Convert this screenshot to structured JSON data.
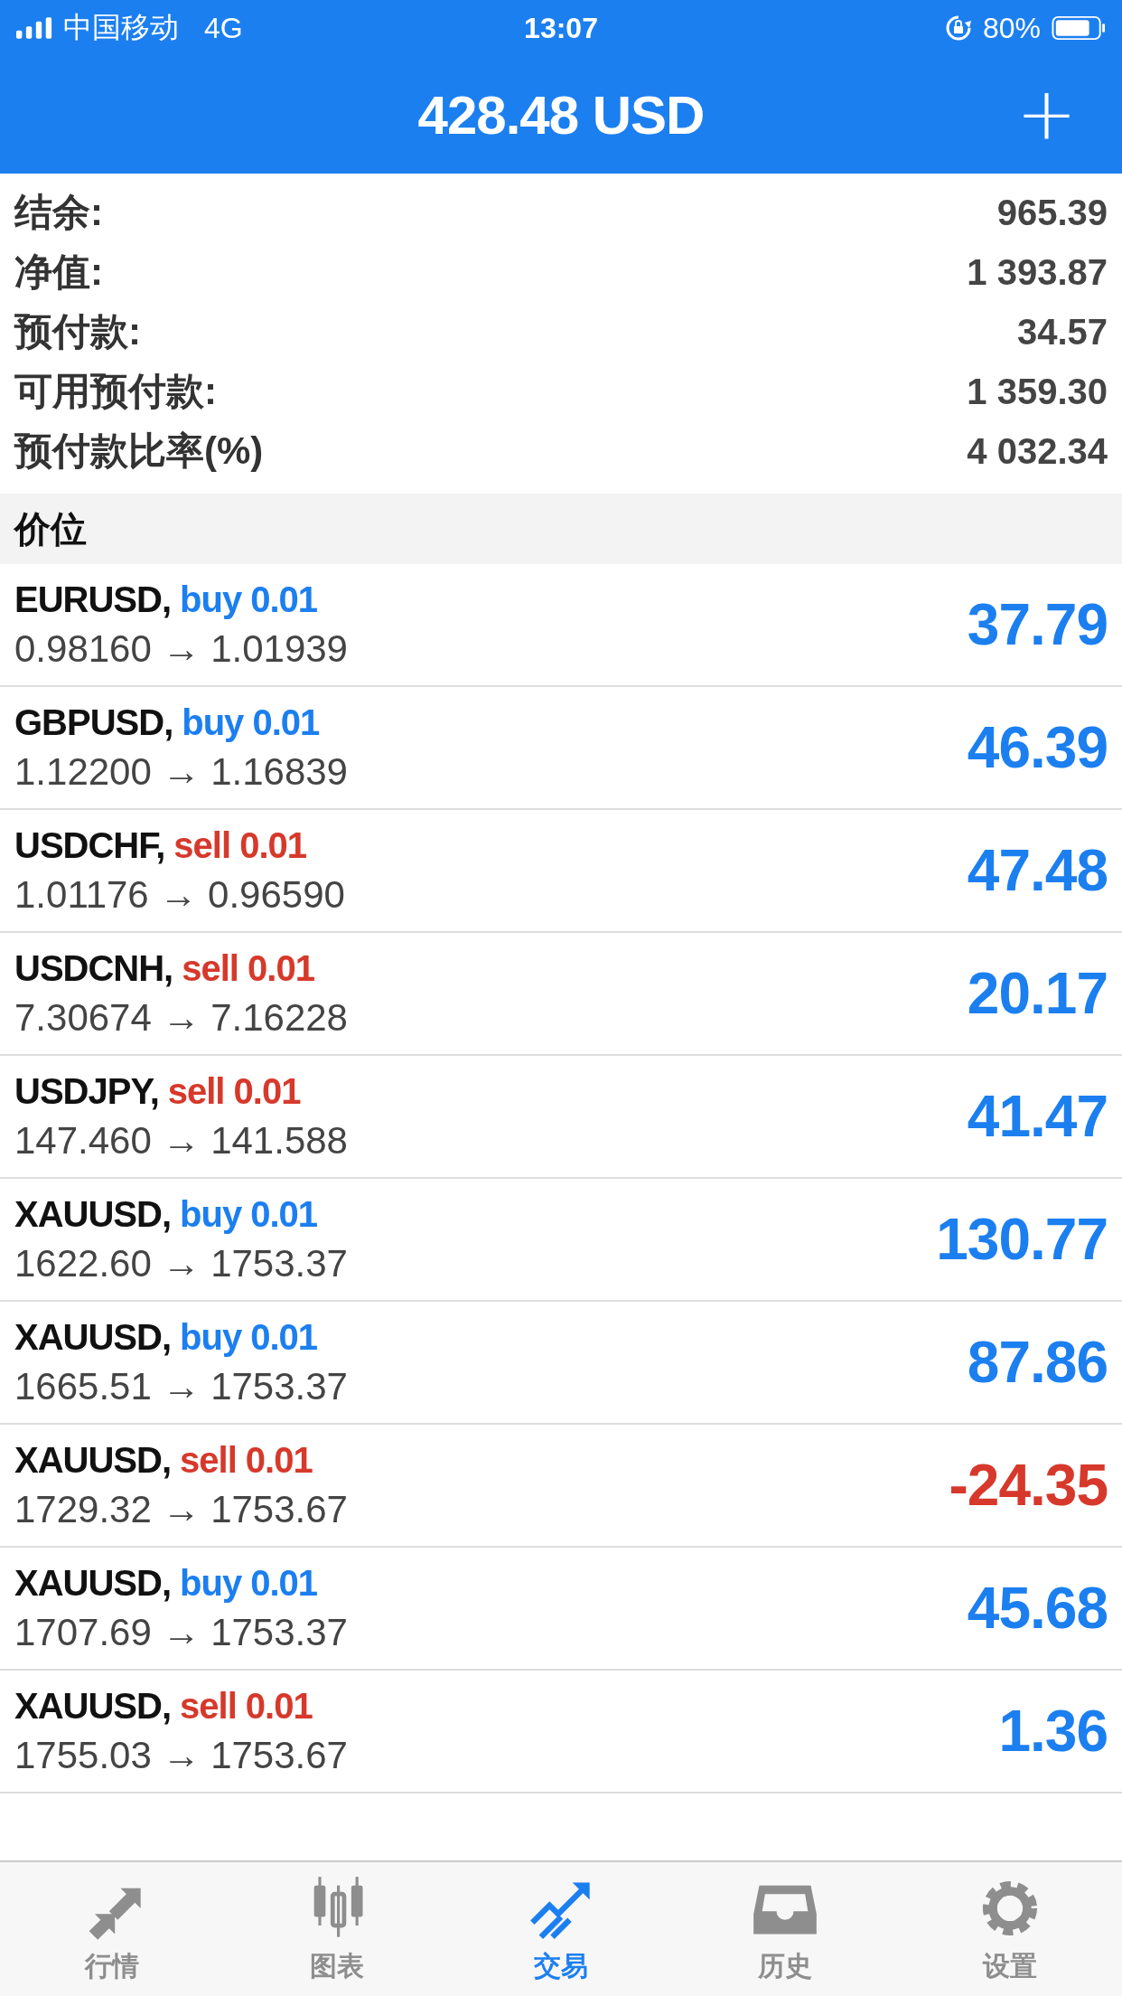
{
  "status_bar": {
    "carrier": "中国移动",
    "network": "4G",
    "time": "13:07",
    "battery": "80%"
  },
  "header": {
    "title": "428.48 USD",
    "add": "+"
  },
  "summary": [
    {
      "label": "结余:",
      "value": "965.39"
    },
    {
      "label": "净值:",
      "value": "1 393.87"
    },
    {
      "label": "预付款:",
      "value": "34.57"
    },
    {
      "label": "可用预付款:",
      "value": "1 359.30"
    },
    {
      "label": "预付款比率(%)",
      "value": "4 032.34"
    }
  ],
  "section_title": "价位",
  "positions": [
    {
      "symbol": "EURUSD,",
      "kind": "buy",
      "side": "buy 0.01",
      "prices": "0.98160 → 1.01939",
      "profit": "37.79",
      "loss": false
    },
    {
      "symbol": "GBPUSD,",
      "kind": "buy",
      "side": "buy 0.01",
      "prices": "1.12200 → 1.16839",
      "profit": "46.39",
      "loss": false
    },
    {
      "symbol": "USDCHF,",
      "kind": "sell",
      "side": "sell 0.01",
      "prices": "1.01176 → 0.96590",
      "profit": "47.48",
      "loss": false
    },
    {
      "symbol": "USDCNH,",
      "kind": "sell",
      "side": "sell 0.01",
      "prices": "7.30674 → 7.16228",
      "profit": "20.17",
      "loss": false
    },
    {
      "symbol": "USDJPY,",
      "kind": "sell",
      "side": "sell 0.01",
      "prices": "147.460 → 141.588",
      "profit": "41.47",
      "loss": false
    },
    {
      "symbol": "XAUUSD,",
      "kind": "buy",
      "side": "buy 0.01",
      "prices": "1622.60 → 1753.37",
      "profit": "130.77",
      "loss": false
    },
    {
      "symbol": "XAUUSD,",
      "kind": "buy",
      "side": "buy 0.01",
      "prices": "1665.51 → 1753.37",
      "profit": "87.86",
      "loss": false
    },
    {
      "symbol": "XAUUSD,",
      "kind": "sell",
      "side": "sell 0.01",
      "prices": "1729.32 → 1753.67",
      "profit": "-24.35",
      "loss": true
    },
    {
      "symbol": "XAUUSD,",
      "kind": "buy",
      "side": "buy 0.01",
      "prices": "1707.69 → 1753.37",
      "profit": "45.68",
      "loss": false
    },
    {
      "symbol": "XAUUSD,",
      "kind": "sell",
      "side": "sell 0.01",
      "prices": "1755.03 → 1753.67",
      "profit": "1.36",
      "loss": false
    }
  ],
  "tabs": [
    {
      "label": "行情",
      "kind": "quotes",
      "selected": false
    },
    {
      "label": "图表",
      "kind": "chart",
      "selected": false
    },
    {
      "label": "交易",
      "kind": "trade",
      "selected": true
    },
    {
      "label": "历史",
      "kind": "history",
      "selected": false
    },
    {
      "label": "设置",
      "kind": "settings",
      "selected": false
    }
  ]
}
